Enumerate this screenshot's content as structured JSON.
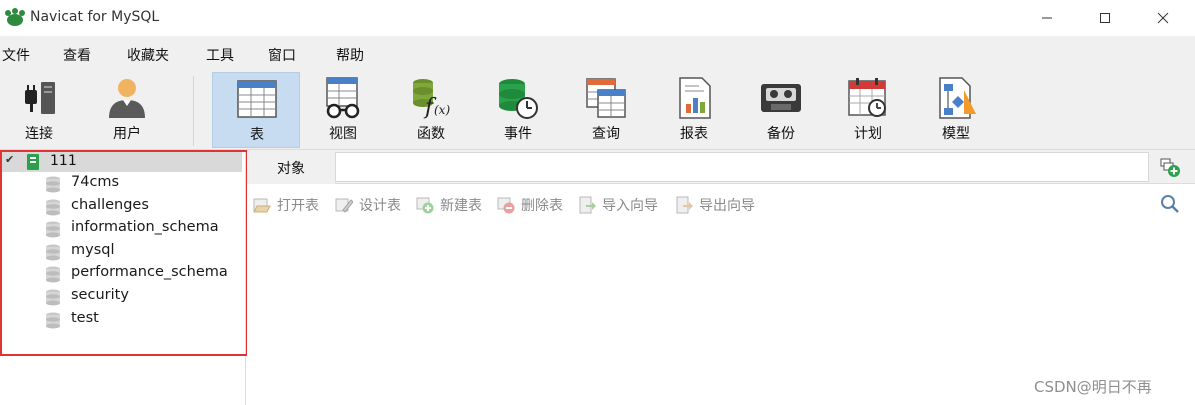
{
  "window": {
    "title": "Navicat for MySQL"
  },
  "menu": [
    "文件",
    "查看",
    "收藏夹",
    "工具",
    "窗口",
    "帮助"
  ],
  "toolbar": {
    "active": "表",
    "items": [
      {
        "label": "连接",
        "icon": "connection-plug-icon"
      },
      {
        "label": "用户",
        "icon": "user-icon"
      },
      {
        "label": "表",
        "icon": "table-icon"
      },
      {
        "label": "视图",
        "icon": "view-glasses-icon"
      },
      {
        "label": "函数",
        "icon": "function-fx-icon"
      },
      {
        "label": "事件",
        "icon": "event-clock-icon"
      },
      {
        "label": "查询",
        "icon": "query-icon"
      },
      {
        "label": "报表",
        "icon": "report-icon"
      },
      {
        "label": "备份",
        "icon": "backup-tape-icon"
      },
      {
        "label": "计划",
        "icon": "schedule-calendar-icon"
      },
      {
        "label": "模型",
        "icon": "model-diagram-icon"
      }
    ]
  },
  "sidebar": {
    "connection": {
      "name": "111",
      "expanded": true
    },
    "databases": [
      "74cms",
      "challenges",
      "information_schema",
      "mysql",
      "performance_schema",
      "security",
      "test"
    ]
  },
  "objects_tab": {
    "label": "对象"
  },
  "actions": [
    "打开表",
    "设计表",
    "新建表",
    "删除表",
    "导入向导",
    "导出向导"
  ],
  "watermark": "CSDN@明日不再",
  "colors": {
    "selection": "#c7dcf0",
    "highlight_box": "#e03434",
    "disabled_text": "#8a8a8a"
  }
}
